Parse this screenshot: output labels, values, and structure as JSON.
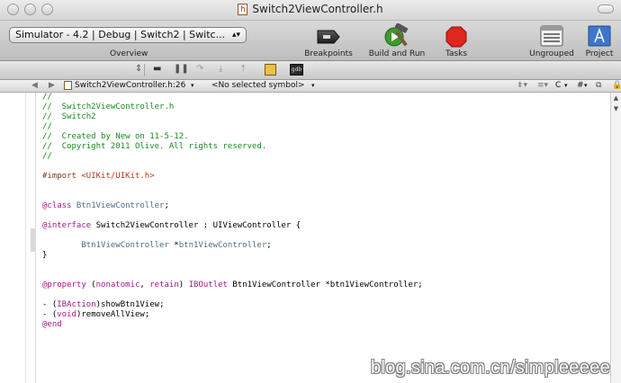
{
  "window": {
    "title": "Switch2ViewController.h",
    "title_icon": "h"
  },
  "toolbar": {
    "scheme_label": "Simulator - 4.2 | Debug | Switch2 | Switc...",
    "overview_label": "Overview",
    "breakpoints_label": "Breakpoints",
    "build_and_run_label": "Build and Run",
    "tasks_label": "Tasks",
    "ungrouped_label": "Ungrouped",
    "project_label": "Project"
  },
  "navbar": {
    "file_label": "Switch2ViewController.h:26",
    "symbol_label": "<No selected symbol>",
    "right_controls": [
      "C",
      "#"
    ]
  },
  "code_lines": [
    [
      {
        "c": "cm",
        "t": "//"
      }
    ],
    [
      {
        "c": "cm",
        "t": "//  Switch2ViewController.h"
      }
    ],
    [
      {
        "c": "cm",
        "t": "//  Switch2"
      }
    ],
    [
      {
        "c": "cm",
        "t": "//"
      }
    ],
    [
      {
        "c": "cm",
        "t": "//  Created by New on 11-5-12."
      }
    ],
    [
      {
        "c": "cm",
        "t": "//  Copyright 2011 Olive. All rights reserved."
      }
    ],
    [
      {
        "c": "cm",
        "t": "//"
      }
    ],
    [],
    [
      {
        "c": "pp",
        "t": "#import "
      },
      {
        "c": "st",
        "t": "<UIKit/UIKit.h>"
      }
    ],
    [],
    [],
    [
      {
        "c": "kw",
        "t": "@class"
      },
      {
        "c": "ty",
        "t": " Btn1ViewController"
      },
      {
        "c": "",
        "t": ";"
      }
    ],
    [],
    [
      {
        "c": "kw",
        "t": "@interface"
      },
      {
        "c": "",
        "t": " Switch2ViewController : UIViewController {"
      }
    ],
    [],
    [
      {
        "c": "ty",
        "t": "        Btn1ViewController"
      },
      {
        "c": "",
        "t": " *"
      },
      {
        "c": "ty",
        "t": "btn1ViewController"
      },
      {
        "c": "",
        "t": ";"
      }
    ],
    [
      {
        "c": "",
        "t": "}"
      }
    ],
    [],
    [],
    [
      {
        "c": "kw",
        "t": "@property"
      },
      {
        "c": "",
        "t": " ("
      },
      {
        "c": "kw",
        "t": "nonatomic"
      },
      {
        "c": "",
        "t": ", "
      },
      {
        "c": "kw",
        "t": "retain"
      },
      {
        "c": "",
        "t": ") "
      },
      {
        "c": "kw",
        "t": "IBOutlet"
      },
      {
        "c": "",
        "t": " Btn1ViewController *btn1ViewController;"
      }
    ],
    [],
    [
      {
        "c": "",
        "t": "- ("
      },
      {
        "c": "kw",
        "t": "IBAction"
      },
      {
        "c": "",
        "t": ")showBtn1View;"
      }
    ],
    [
      {
        "c": "",
        "t": "- ("
      },
      {
        "c": "kw",
        "t": "void"
      },
      {
        "c": "",
        "t": ")removeAllView;"
      }
    ],
    [
      {
        "c": "kw",
        "t": "@end"
      }
    ]
  ],
  "watermark": "blog.sina.com.cn/simpleeeee"
}
